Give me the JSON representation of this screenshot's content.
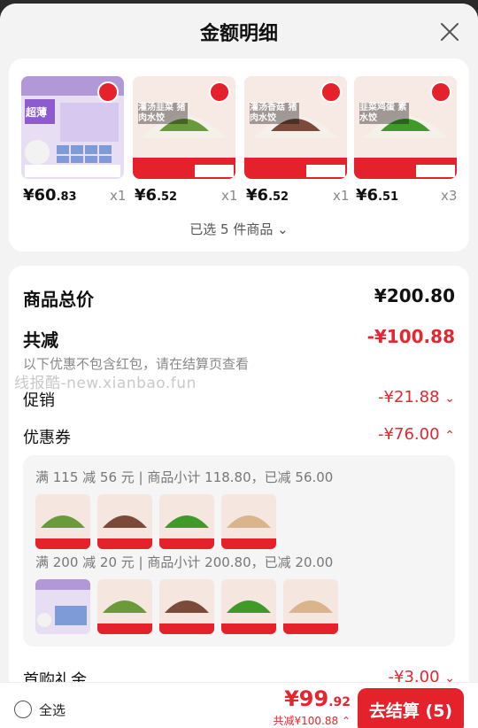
{
  "header": {
    "title": "金额明细"
  },
  "products": [
    {
      "price_main": "¥60",
      "price_dec": ".83",
      "qty": "x1",
      "overlay_text": "超薄"
    },
    {
      "price_main": "¥6",
      "price_dec": ".52",
      "qty": "x1",
      "overlay_text": "灌汤韭菜 猪肉水饺"
    },
    {
      "price_main": "¥6",
      "price_dec": ".52",
      "qty": "x1",
      "overlay_text": "灌汤香菇 猪肉水饺"
    },
    {
      "price_main": "¥6",
      "price_dec": ".51",
      "qty": "x3",
      "overlay_text": "韭菜鸡蛋 素水饺"
    }
  ],
  "selected_summary": "已选 5 件商品",
  "summary": {
    "subtotal_label": "商品总价",
    "subtotal_value": "¥200.80",
    "discount_label": "共减",
    "discount_value": "-¥100.88",
    "discount_note": "以下优惠不包含红包，请在结算页查看",
    "promo_label": "促销",
    "promo_value": "-¥21.88",
    "coupon_label": "优惠券",
    "coupon_value": "-¥76.00",
    "coupon_lines": [
      "满 115 减 56 元 | 商品小计 118.80，已减 56.00",
      "满 200 减 20 元 | 商品小计 200.80，已减 20.00"
    ],
    "first_gift_label": "首购礼金",
    "first_gift_value": "-¥3.00"
  },
  "watermark": "线报酷-new.xianbao.fun",
  "footer": {
    "select_all": "全选",
    "total_main": "¥99",
    "total_dec": ".92",
    "saved": "共减¥100.88",
    "checkout": "去结算 (5)"
  },
  "colors": {
    "accent": "#e5212b",
    "text_red": "#e4262f"
  }
}
